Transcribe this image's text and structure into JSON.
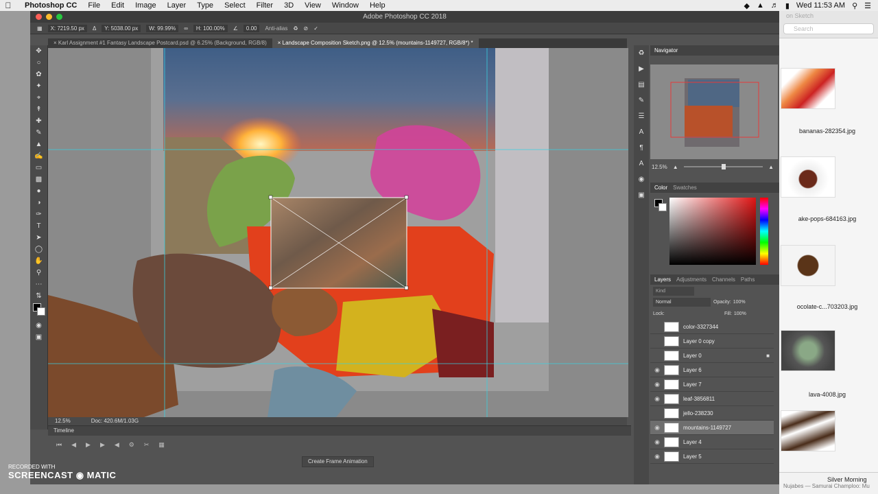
{
  "menubar": {
    "app_name": "Photoshop CC",
    "items": [
      "File",
      "Edit",
      "Image",
      "Layer",
      "Type",
      "Select",
      "Filter",
      "3D",
      "View",
      "Window",
      "Help"
    ],
    "clock": "Wed 11:53 AM"
  },
  "window": {
    "title": "Adobe Photoshop CC 2018"
  },
  "options": {
    "x": "X: 7219.50 px",
    "y": "Y: 5038.00 px",
    "w": "W: 99.99%",
    "h": "H: 100.00%",
    "angle": "0.00",
    "antialias": "Anti-alias"
  },
  "tabs": [
    {
      "label": "Karl Assignment #1 Fantasy Landscape Postcard.psd @ 6.25% (Background, RGB/8)"
    },
    {
      "label": "Landscape Composition Sketch.png @ 12.5% (mountains-1149727, RGB/8*) *"
    }
  ],
  "status": {
    "zoom": "12.5%",
    "doc": "Doc: 420.6M/1.03G"
  },
  "timeline": {
    "title": "Timeline",
    "button": "Create Frame Animation"
  },
  "navigator": {
    "title": "Navigator",
    "zoom": "12.5%"
  },
  "color": {
    "tab1": "Color",
    "tab2": "Swatches"
  },
  "layers_panel": {
    "tabs": [
      "Layers",
      "Adjustments",
      "Channels",
      "Paths"
    ],
    "blend": "Normal",
    "opacity_label": "Opacity:",
    "opacity": "100%",
    "lock_label": "Lock:",
    "fill_label": "Fill:",
    "fill": "100%",
    "search": "Kind",
    "layers": [
      {
        "name": "color-3327344",
        "visible": false
      },
      {
        "name": "Layer 0 copy",
        "visible": false
      },
      {
        "name": "Layer 0",
        "visible": false,
        "locked": true
      },
      {
        "name": "Layer 6",
        "visible": true
      },
      {
        "name": "Layer 7",
        "visible": true
      },
      {
        "name": "leaf-3856811",
        "visible": true
      },
      {
        "name": "jello-238230",
        "visible": false
      },
      {
        "name": "mountains-1149727",
        "visible": true,
        "selected": true
      },
      {
        "name": "Layer 4",
        "visible": true
      },
      {
        "name": "Layer 5",
        "visible": true
      }
    ]
  },
  "finder": {
    "title": "on Sketch",
    "search": "Search",
    "files": [
      "bananas-282354.jpg",
      "ake-pops-684163.jpg",
      "ocolate-c...703203.jpg",
      "lava-4008.jpg"
    ]
  },
  "music": {
    "title": "Silver Morning",
    "artist": "Nujabes — Samurai Champloo: Mu"
  },
  "recorder": {
    "line1": "RECORDED WITH",
    "brand": "SCREENCAST",
    "brand2": "MATIC"
  }
}
